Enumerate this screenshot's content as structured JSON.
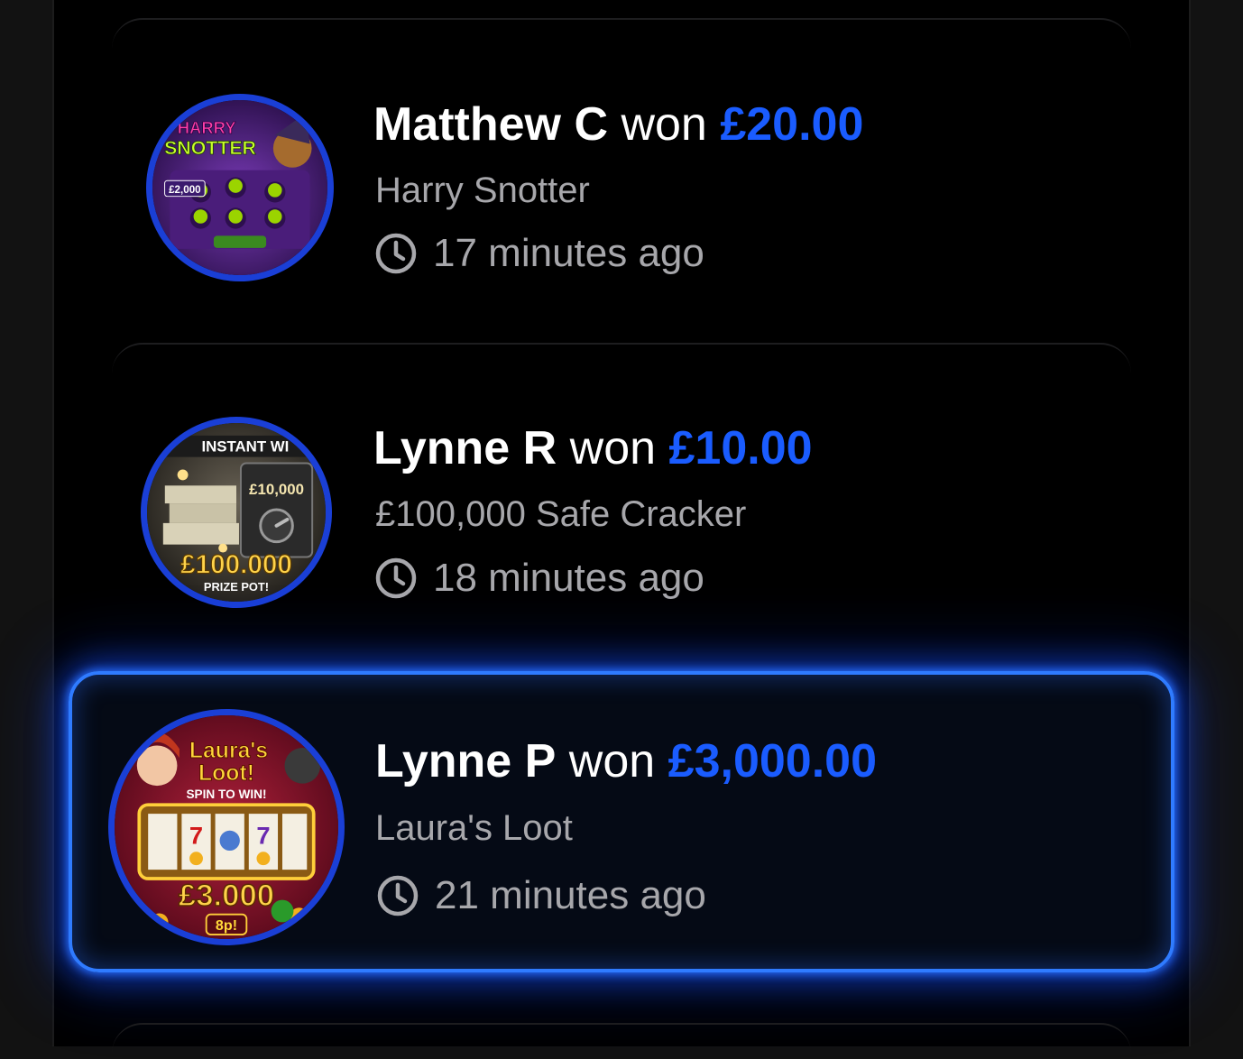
{
  "colors": {
    "amount_blue": "#1a5cff",
    "highlight_glow": "#2f7bff",
    "background": "#000000",
    "secondary_text": "#a7a7ab"
  },
  "winners": [
    {
      "name": "Matthew C",
      "won_text": "won",
      "amount": "£20.00",
      "game": "Harry Snotter",
      "time": "17 minutes ago",
      "thumbnail": {
        "title_line1": "HARRY",
        "title_line2": "SNOTTER",
        "prize": "£2,000"
      }
    },
    {
      "name": "Lynne R",
      "won_text": "won",
      "amount": "£10.00",
      "game": "£100,000 Safe Cracker",
      "time": "18 minutes ago",
      "thumbnail": {
        "banner": "INSTANT WI",
        "prize_small": "£10,000",
        "prize_big": "£100.000",
        "subtitle": "PRIZE POT!"
      }
    },
    {
      "name": "Lynne P",
      "won_text": "won",
      "amount": "£3,000.00",
      "game": "Laura's Loot",
      "time": "21 minutes ago",
      "highlighted": true,
      "thumbnail": {
        "title_line1": "Laura's",
        "title_line2": "Loot!",
        "tagline": "SPIN TO WIN!",
        "prize": "£3.000",
        "price": "8p!"
      }
    }
  ],
  "icons": {
    "time": "clock-icon"
  }
}
